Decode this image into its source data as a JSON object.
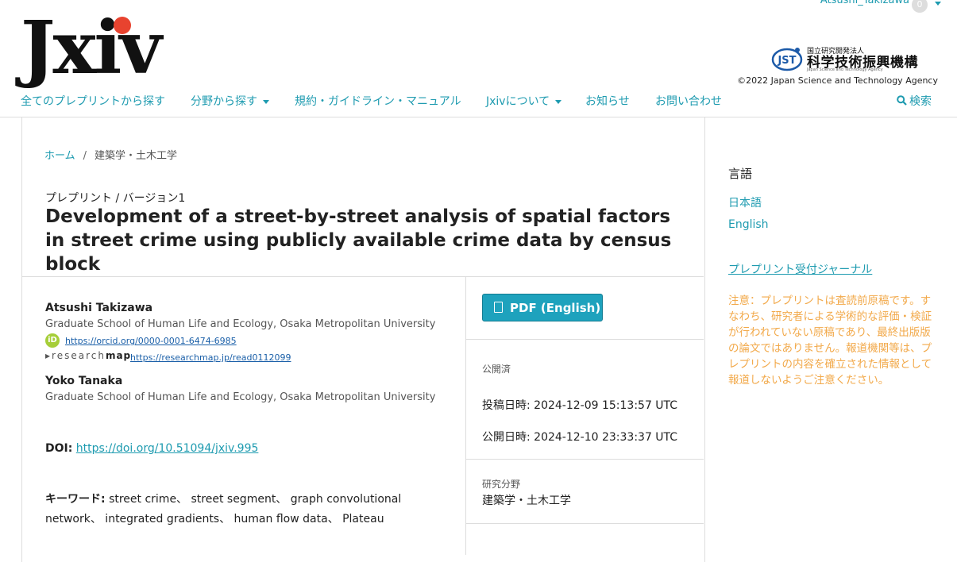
{
  "header": {
    "user_name": "Atsushi_Takizawa",
    "notification_count": "0",
    "logo_text": "Jxiv",
    "jst_mark": "JST",
    "jst_small": "国立研究開発法人",
    "jst_name": "科学技術振興機構",
    "jst_eng": "Japan Science and Technology Agency",
    "copyright": "©2022 Japan Science and Technology Agency"
  },
  "nav": {
    "items": [
      {
        "label": "全てのプレプリントから探す"
      },
      {
        "label": "分野から探す"
      },
      {
        "label": "規約・ガイドライン・マニュアル"
      },
      {
        "label": "Jxivについて"
      },
      {
        "label": "お知らせ"
      },
      {
        "label": "お問い合わせ"
      }
    ],
    "search": "検索"
  },
  "breadcrumb": {
    "home": "ホーム",
    "separator": "/",
    "current": "建築学・土木工学"
  },
  "article": {
    "version_label": "プレプリント / バージョン1",
    "title": "Development of a street-by-street analysis of spatial factors in street crime using publicly available crime data by census block",
    "authors": [
      {
        "name": "Atsushi Takizawa",
        "affiliation": "Graduate School of Human Life and Ecology, Osaka Metropolitan University",
        "orcid": "https://orcid.org/0000-0001-6474-6985",
        "researchmap_logo": "research",
        "researchmap_logo_bold": "map",
        "researchmap": "https://researchmap.jp/read0112099"
      },
      {
        "name": "Yoko Tanaka",
        "affiliation": "Graduate School of Human Life and Ecology, Osaka Metropolitan University"
      }
    ],
    "doi_label": "DOI:",
    "doi": "https://doi.org/10.51094/jxiv.995",
    "keywords_label": "キーワード:",
    "keywords": "street crime、 street segment、 graph convolutional network、 integrated gradients、 human flow data、 Plateau"
  },
  "side": {
    "pdf_button": "PDF (English)",
    "status": "公開済",
    "submitted": "投稿日時: 2024-12-09 15:13:57 UTC",
    "posted": "公開日時: 2024-12-10 23:33:37 UTC",
    "field_label": "研究分野",
    "field_value": "建築学・土木工学"
  },
  "sidebar": {
    "language_heading": "言語",
    "lang_ja": "日本語",
    "lang_en": "English",
    "journal_link": "プレプリント受付ジャーナル",
    "notice": "注意：プレプリントは査読前原稿です。すなわち、研究者による学術的な評価・検証が行われていない原稿であり、最終出版版の論文ではありません。報道機関等は、プレプリントの内容を確立された情報として報道しないようご注意ください。"
  },
  "colors": {
    "accent": "#1e9bb0",
    "logo_dot": "#e8432f",
    "notice": "#f2a94a",
    "button": "#1ea2bd"
  }
}
